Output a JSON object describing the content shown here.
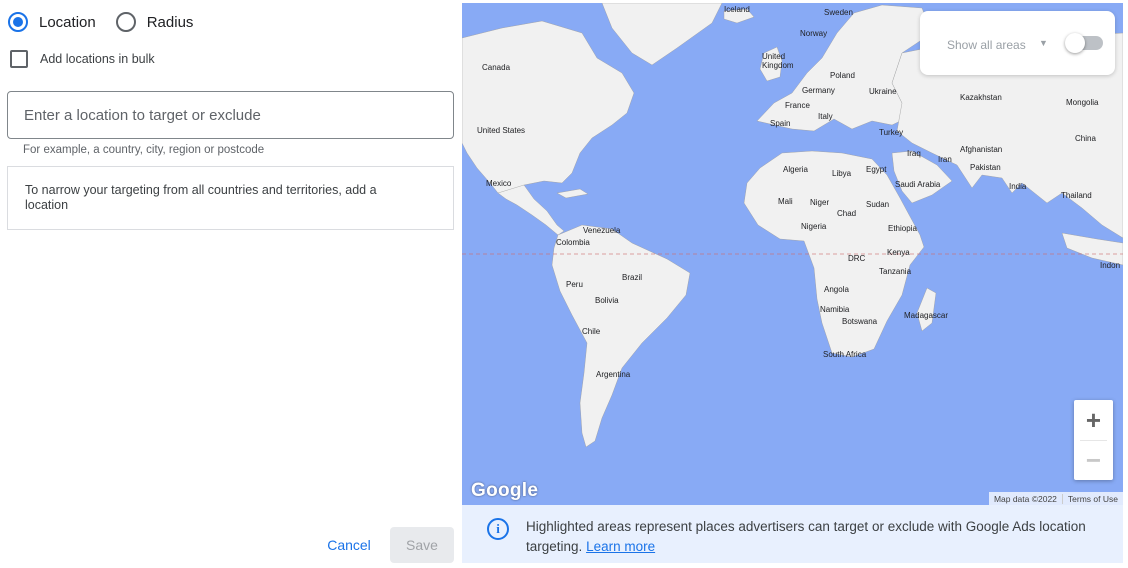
{
  "targeting": {
    "options": [
      {
        "label": "Location",
        "selected": true
      },
      {
        "label": "Radius",
        "selected": false
      }
    ],
    "bulk_label": "Add locations in bulk",
    "input_placeholder": "Enter a location to target or exclude",
    "input_value": "",
    "hint": "For example, a country, city, region or postcode",
    "narrow_message": "To narrow your targeting from all countries and territories, add a location"
  },
  "actions": {
    "cancel_label": "Cancel",
    "save_label": "Save"
  },
  "map": {
    "show_all_label": "Show all areas",
    "show_all_enabled": false,
    "zoom_in_label": "+",
    "zoom_out_label": "−",
    "logo_text": "Google",
    "attribution": "Map data ©2022",
    "terms_label": "Terms of Use",
    "labels": [
      "Iceland",
      "Sweden",
      "Norway",
      "Canada",
      "United Kingdom",
      "Poland",
      "Germany",
      "Ukraine",
      "Kazakhstan",
      "Mongolia",
      "France",
      "Italy",
      "Spain",
      "Turkey",
      "China",
      "United States",
      "Afghanistan",
      "Iraq",
      "Iran",
      "Pakistan",
      "Algeria",
      "Libya",
      "Egypt",
      "Saudi Arabia",
      "India",
      "Mexico",
      "Thailand",
      "Mali",
      "Niger",
      "Chad",
      "Sudan",
      "Nigeria",
      "Ethiopia",
      "Venezuela",
      "Colombia",
      "Kenya",
      "DRC",
      "Indon",
      "Tanzania",
      "Brazil",
      "Peru",
      "Angola",
      "Bolivia",
      "Namibia",
      "Botswana",
      "Madagascar",
      "Chile",
      "South Africa",
      "Argentina"
    ]
  },
  "info": {
    "text": "Highlighted areas represent places advertisers can target or exclude with Google Ads location targeting.",
    "link": "Learn more"
  },
  "colors": {
    "accent": "#1a73e8",
    "ocean": "#88aaf5",
    "land": "#f1f1f1",
    "info_bg": "#e8f0fe"
  }
}
